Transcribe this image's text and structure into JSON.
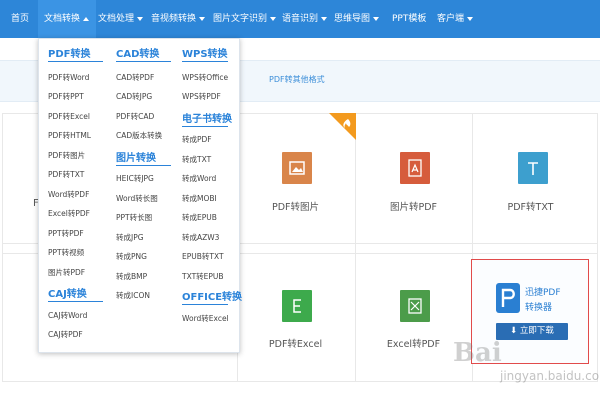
{
  "nav": {
    "items": [
      {
        "label": "首页"
      },
      {
        "label": "文档转换",
        "active": true
      },
      {
        "label": "文档处理"
      },
      {
        "label": "音视频转换"
      },
      {
        "label": "图片文字识别"
      },
      {
        "label": "语音识别"
      },
      {
        "label": "思维导图"
      },
      {
        "label": "PPT模板"
      },
      {
        "label": "客户端"
      }
    ]
  },
  "strip": {
    "link": "PDF转其他格式"
  },
  "dropdown": {
    "pdf": {
      "heading": "PDF转换",
      "items": [
        "PDF转Word",
        "PDF转PPT",
        "PDF转Excel",
        "PDF转HTML",
        "PDF转图片",
        "PDF转TXT",
        "Word转PDF",
        "Excel转PDF",
        "PPT转PDF",
        "PPT转视频",
        "图片转PDF"
      ]
    },
    "caj": {
      "heading": "CAJ转换",
      "items": [
        "CAJ转Word",
        "CAJ转PDF"
      ]
    },
    "cad": {
      "heading": "CAD转换",
      "items": [
        "CAD转PDF",
        "CAD转JPG",
        "PDF转CAD",
        "CAD版本转换"
      ]
    },
    "img": {
      "heading": "图片转换",
      "items": [
        "HEIC转JPG",
        "Word转长图",
        "PPT转长图",
        "转成JPG",
        "转成PNG",
        "转成BMP",
        "转成ICON"
      ]
    },
    "wps": {
      "heading": "WPS转换",
      "items": [
        "WPS转Office",
        "WPS转PDF"
      ]
    },
    "ebook": {
      "heading": "电子书转换",
      "items": [
        "转成PDF",
        "转成TXT",
        "转成Word",
        "转成MOBI",
        "转成EPUB",
        "转成AZW3",
        "EPUB转TXT",
        "TXT转EPUB"
      ]
    },
    "office": {
      "heading": "OFFICE转换",
      "items": [
        "Word转Excel"
      ]
    }
  },
  "tiles": {
    "row1": [
      "PDF转图片",
      "图片转PDF",
      "PDF转TXT"
    ],
    "row2": [
      "PDF转Excel",
      "Excel转PDF"
    ],
    "partial": "F"
  },
  "icons": {
    "tile1": "image-icon",
    "tile2": "pdf-icon",
    "tile3": "text-icon",
    "tile4": "excel-icon",
    "tile5": "pdf-excel-icon",
    "hot": "fire-icon"
  },
  "colors": {
    "nav": "#2d86d8",
    "accent": "#2b83d9",
    "hot": "#f39a1e",
    "image": "#d9854a",
    "pdf": "#d65c3c",
    "txt": "#3d9fce",
    "excel": "#3daa4c",
    "excelpdf": "#4c9c4a"
  },
  "ad": {
    "title_line1": "迅捷PDF",
    "title_line2": "转换器",
    "button": "立即下载"
  },
  "watermark": {
    "brand": "Bai",
    "sub": "jingyan.baidu.com"
  }
}
